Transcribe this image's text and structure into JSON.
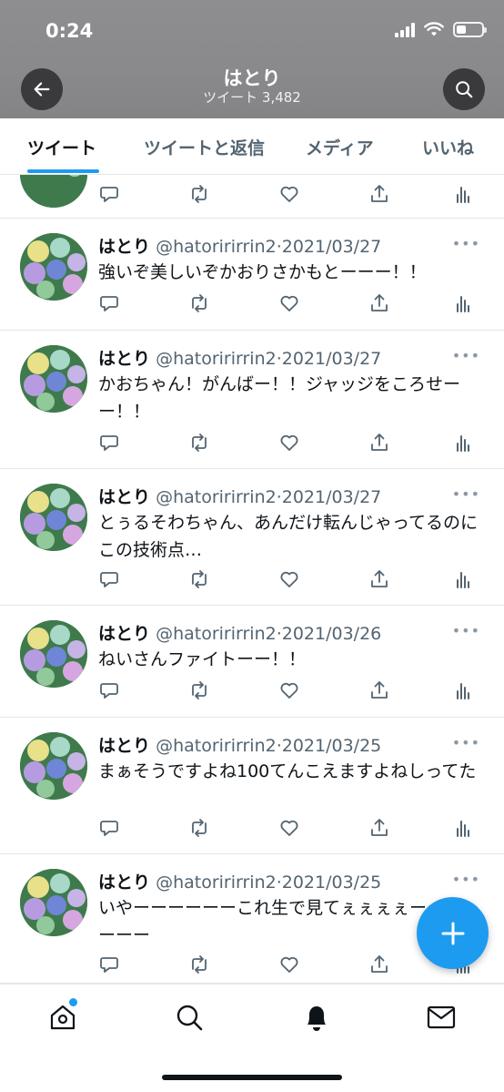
{
  "status_bar": {
    "time": "0:24"
  },
  "header": {
    "title": "はとり",
    "subtitle": "ツイート 3,482",
    "back_icon": "arrow-left-icon",
    "search_icon": "search-icon"
  },
  "tabs": [
    {
      "label": "ツイート",
      "active": true
    },
    {
      "label": "ツイートと返信",
      "active": false
    },
    {
      "label": "メディア",
      "active": false
    },
    {
      "label": "いいね",
      "active": false
    }
  ],
  "tweets": [
    {
      "name": "はとり",
      "handle": "@hatoririrrin2",
      "sep": "·",
      "date": "2021/03/27",
      "text": "強いぞ美しいぞかおりさかもとーーー！！"
    },
    {
      "name": "はとり",
      "handle": "@hatoririrrin2",
      "sep": "·",
      "date": "2021/03/27",
      "text": "かおちゃん！がんばー！！ジャッジをころせーー！！"
    },
    {
      "name": "はとり",
      "handle": "@hatoririrrin2",
      "sep": "·",
      "date": "2021/03/27",
      "text": "とぅるそわちゃん、あんだけ転んじゃってるのにこの技術点…"
    },
    {
      "name": "はとり",
      "handle": "@hatoririrrin2",
      "sep": "·",
      "date": "2021/03/26",
      "text": "ねいさんファイトーー！！"
    },
    {
      "name": "はとり",
      "handle": "@hatoririrrin2",
      "sep": "·",
      "date": "2021/03/25",
      "text": "まぁそうですよね100てんこえますよねしってた"
    },
    {
      "name": "はとり",
      "handle": "@hatoririrrin2",
      "sep": "·",
      "date": "2021/03/25",
      "text": "いやーーーーーーこれ生で見てぇぇぇぇーーーーーーー"
    }
  ],
  "more_glyph": "•••",
  "tweet_actions": [
    "reply-icon",
    "retweet-icon",
    "like-icon",
    "share-icon",
    "analytics-icon"
  ],
  "fab": {
    "icon": "plus-icon"
  },
  "bottom_nav": [
    "home-icon",
    "search-icon",
    "bell-icon",
    "mail-icon"
  ],
  "colors": {
    "accent": "#1d9bf0",
    "text": "#0f1419",
    "secondary": "#536471",
    "header_bg": "#8b8b8d"
  }
}
